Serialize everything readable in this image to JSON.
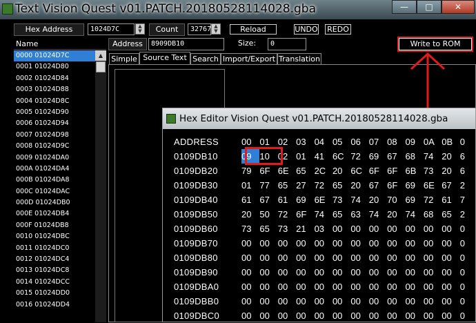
{
  "main_window": {
    "title": "Text Vision Quest v01.PATCH.20180528114028.gba",
    "ghost_title": "Hex...028.gba"
  },
  "toolbar": {
    "hex_address_label": "Hex Address",
    "hex_address_value": "1024D7C",
    "count_label": "Count",
    "count_value": "32767",
    "reload": "Reload",
    "undo": "UNDO",
    "redo": "REDO"
  },
  "list": {
    "header": "Name",
    "items": [
      "0000 01024D7C",
      "0001 01024D80",
      "0002 01024D84",
      "0003 01024D88",
      "0004 01024D8C",
      "0005 01024D90",
      "0006 01024D94",
      "0007 01024D98",
      "0008 01024D9C",
      "0009 01024DA0",
      "000A 01024DA4",
      "000B 01024DA8",
      "000C 01024DAC",
      "000D 01024DB0",
      "000E 01024DB4",
      "000F 01024DB8",
      "0010 01024DBC",
      "0011 01024DC0",
      "0012 01024DC4",
      "0013 01024DC8",
      "0014 01024DCC",
      "0015 01024DD0",
      "0016 01024DD4"
    ]
  },
  "detail": {
    "address_label": "Address",
    "address_value": "8909DB10",
    "size_label": "Size:",
    "size_value": "0",
    "write_rom": "Write to ROM",
    "tabs": [
      "Simple",
      "Source Text",
      "Search",
      "Import/Export",
      "Translation"
    ]
  },
  "hex_editor": {
    "title": "Hex Editor Vision Quest v01.PATCH.20180528114028.gba",
    "header_label": "ADDRESS",
    "columns": [
      "00",
      "01",
      "02",
      "03",
      "04",
      "05",
      "06",
      "07",
      "08",
      "09",
      "0A",
      "0B",
      "0"
    ],
    "rows": [
      {
        "addr": "0109DB10",
        "bytes": [
          "09",
          "10",
          "02",
          "01",
          "41",
          "6C",
          "72",
          "69",
          "67",
          "68",
          "74",
          "20",
          "6"
        ]
      },
      {
        "addr": "0109DB20",
        "bytes": [
          "79",
          "6F",
          "6E",
          "65",
          "2C",
          "20",
          "6C",
          "6F",
          "6F",
          "6B",
          "73",
          "20",
          "6"
        ]
      },
      {
        "addr": "0109DB30",
        "bytes": [
          "01",
          "77",
          "65",
          "27",
          "72",
          "65",
          "20",
          "67",
          "6F",
          "69",
          "6E",
          "67",
          "2"
        ]
      },
      {
        "addr": "0109DB40",
        "bytes": [
          "61",
          "67",
          "61",
          "69",
          "6E",
          "73",
          "74",
          "20",
          "70",
          "69",
          "72",
          "61",
          "7"
        ]
      },
      {
        "addr": "0109DB50",
        "bytes": [
          "20",
          "50",
          "72",
          "6F",
          "74",
          "65",
          "63",
          "74",
          "20",
          "74",
          "68",
          "65",
          "2"
        ]
      },
      {
        "addr": "0109DB60",
        "bytes": [
          "73",
          "65",
          "73",
          "21",
          "03",
          "00",
          "00",
          "00",
          "00",
          "00",
          "00",
          "00",
          "0"
        ]
      },
      {
        "addr": "0109DB70",
        "bytes": [
          "00",
          "00",
          "00",
          "00",
          "00",
          "00",
          "00",
          "00",
          "00",
          "00",
          "00",
          "00",
          "0"
        ]
      },
      {
        "addr": "0109DB80",
        "bytes": [
          "00",
          "00",
          "00",
          "00",
          "00",
          "00",
          "00",
          "00",
          "00",
          "00",
          "00",
          "00",
          "0"
        ]
      },
      {
        "addr": "0109DB90",
        "bytes": [
          "00",
          "00",
          "00",
          "00",
          "00",
          "00",
          "00",
          "00",
          "00",
          "00",
          "00",
          "00",
          "0"
        ]
      },
      {
        "addr": "0109DBA0",
        "bytes": [
          "00",
          "00",
          "00",
          "00",
          "00",
          "00",
          "00",
          "00",
          "00",
          "00",
          "00",
          "00",
          "0"
        ]
      },
      {
        "addr": "0109DBB0",
        "bytes": [
          "00",
          "00",
          "00",
          "00",
          "00",
          "00",
          "00",
          "00",
          "00",
          "00",
          "00",
          "00",
          "0"
        ]
      },
      {
        "addr": "0109DBC0",
        "bytes": [
          "00",
          "00",
          "00",
          "00",
          "00",
          "00",
          "00",
          "00",
          "00",
          "00",
          "00",
          "00",
          "0"
        ]
      }
    ],
    "selected_byte": "09"
  },
  "icons": {
    "app": "app-icon",
    "hex_app": "hex-app-icon",
    "arrow": "red-arrow-icon"
  },
  "colors": {
    "selection": "#2f7fd6",
    "annotation": "#e31a1a"
  }
}
